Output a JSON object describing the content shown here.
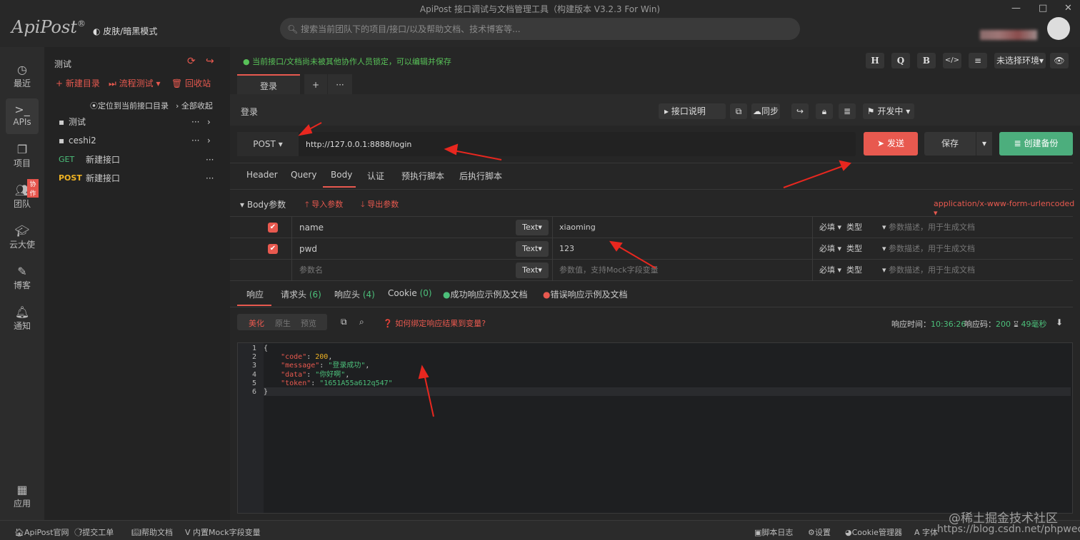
{
  "window": {
    "title": "ApiPost 接口调试与文档管理工具（构建版本 V3.2.3 For Win)",
    "controls": [
      "—",
      "□",
      "✕"
    ]
  },
  "header": {
    "logo": "ApiPost",
    "logo_mark": "®",
    "skin_toggle": "皮肤/暗黑模式",
    "search_placeholder": "搜索当前团队下的项目/接口/以及帮助文档、技术博客等..."
  },
  "nav": {
    "items": [
      {
        "label": "最近",
        "icon": "clock-icon"
      },
      {
        "label": "APIs",
        "icon": "terminal-icon"
      },
      {
        "label": "项目",
        "icon": "project-icon"
      },
      {
        "label": "团队",
        "icon": "team-icon",
        "badge": "协作"
      },
      {
        "label": "云大使",
        "icon": "graduation-cap-icon"
      },
      {
        "label": "博客",
        "icon": "edit-icon"
      },
      {
        "label": "通知",
        "icon": "bell-icon"
      },
      {
        "label": "应用",
        "icon": "grid-icon"
      }
    ]
  },
  "tree": {
    "project": "测试",
    "new_dir": "新建目录",
    "flow_test": "流程测试",
    "recycle": "回收站",
    "locate": "定位到当前接口目录",
    "collapse_all": "全部收起",
    "items": [
      {
        "type": "folder",
        "name": "测试"
      },
      {
        "type": "folder",
        "name": "ceshi2"
      },
      {
        "method": "GET",
        "name": "新建接口"
      },
      {
        "method": "POST",
        "name": "新建接口"
      }
    ]
  },
  "main": {
    "lock_message": "当前接口/文档尚未被其他协作人员锁定，可以编辑并保存",
    "toolbar": {
      "h": "H",
      "q": "Q",
      "b": "B",
      "code": "</>",
      "settings": "≡",
      "env": "未选择环境",
      "eye": "👁"
    },
    "tabs": [
      {
        "label": "登录",
        "active": true
      },
      {
        "label": "+"
      },
      {
        "label": "···"
      }
    ],
    "api_name": "登录",
    "api_actions": {
      "doc": "接口说明",
      "sync": "同步",
      "status": "开发中"
    },
    "request": {
      "method": "POST",
      "url": "http://127.0.0.1:8888/login",
      "send": "发送",
      "save": "保存",
      "backup": "创建备份"
    },
    "req_tabs": [
      "Header",
      "Query",
      "Body",
      "认证",
      "预执行脚本",
      "后执行脚本"
    ],
    "body": {
      "title": "Body参数",
      "import": "导入参数",
      "export": "导出参数",
      "content_type": "application/x-www-form-urlencoded",
      "params": [
        {
          "checked": true,
          "name": "name",
          "type": "Text",
          "value": "xiaoming",
          "required": "必填",
          "vtype": "类型",
          "desc": "参数描述，用于生成文档"
        },
        {
          "checked": true,
          "name": "pwd",
          "type": "Text",
          "value": "123",
          "required": "必填",
          "vtype": "类型",
          "desc": "参数描述，用于生成文档"
        },
        {
          "checked": false,
          "name": "参数名",
          "type": "Text",
          "value": "参数值，支持Mock字段变量",
          "required": "必填",
          "vtype": "类型",
          "desc": "参数描述，用于生成文档"
        }
      ]
    },
    "resp_tabs": [
      {
        "label": "响应"
      },
      {
        "label": "请求头",
        "count": "(6)"
      },
      {
        "label": "响应头",
        "count": "(4)"
      },
      {
        "label": "Cookie",
        "count": "(0)"
      },
      {
        "label": "成功响应示例及文档"
      },
      {
        "label": "错误响应示例及文档"
      }
    ],
    "view_modes": [
      "美化",
      "原生",
      "预览"
    ],
    "bind_help": "如何绑定响应结果到变量?",
    "resp_meta": {
      "time_label": "响应时间：",
      "time": "10:36:26",
      "code_label": "响应码：",
      "code": "200",
      "duration": "49毫秒"
    },
    "response_lines": [
      "1",
      "2",
      "3",
      "4",
      "5",
      "6"
    ],
    "response": {
      "code_key": "\"code\"",
      "code_val": "200",
      "message_key": "\"message\"",
      "message_val": "\"登录成功\"",
      "data_key": "\"data\"",
      "data_val": "\"你好啊\"",
      "token_key": "\"token\"",
      "token_val": "\"1651A55a612q547\""
    }
  },
  "status": {
    "left": [
      "ApiPost官网",
      "提交工单",
      "帮助文档",
      "内置Mock字段变量"
    ],
    "right": [
      "脚本日志",
      "设置",
      "Cookie管理器",
      "字体"
    ]
  },
  "watermark": {
    "line1": "@稀土掘金技术社区",
    "line2": "https://blog.csdn.net/phpwechat"
  },
  "colors": {
    "accent": "#e8594f",
    "success": "#4cbf7a",
    "get": "#4cbf7a",
    "post": "#f0b323",
    "backup": "#4cae7d"
  }
}
